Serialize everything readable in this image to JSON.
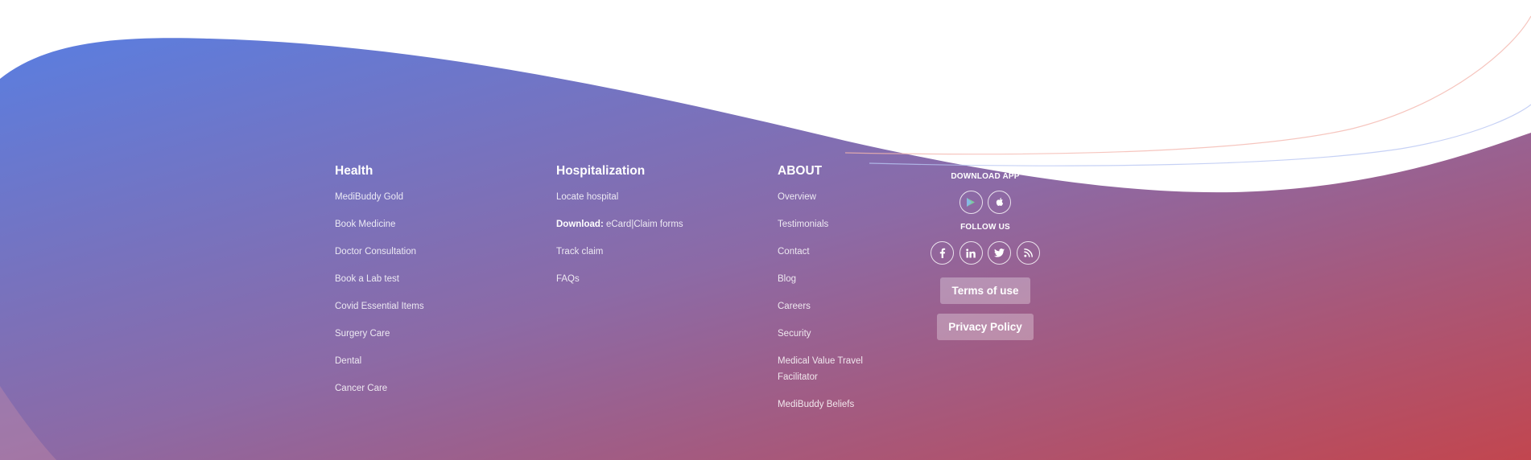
{
  "colors": {
    "gradient_start": "#5a7ee0",
    "gradient_mid": "#8c6aa6",
    "gradient_end": "#c2464f"
  },
  "health": {
    "heading": "Health",
    "links": [
      "MediBuddy Gold",
      "Book Medicine",
      "Doctor Consultation",
      "Book a Lab test",
      "Covid Essential Items",
      "Surgery Care",
      "Dental",
      "Cancer Care"
    ]
  },
  "hospitalization": {
    "heading": "Hospitalization",
    "links": [
      "Locate hospital"
    ],
    "download_prefix": "Download:",
    "download_ecard": "eCard",
    "download_separator": "|",
    "download_claim": "Claim forms",
    "links_after": [
      "Track claim",
      "FAQs"
    ]
  },
  "about": {
    "heading": "ABOUT",
    "links": [
      "Overview",
      "Testimonials",
      "Contact",
      "Blog",
      "Careers",
      "Security",
      "Medical Value Travel Facilitator",
      "MediBuddy Beliefs"
    ]
  },
  "download_app": {
    "heading": "DOWNLOAD APP",
    "icons": [
      "google-play-icon",
      "apple-icon"
    ]
  },
  "follow_us": {
    "heading": "FOLLOW US",
    "icons": [
      "facebook-icon",
      "linkedin-icon",
      "twitter-icon",
      "rss-icon"
    ]
  },
  "legal": {
    "terms": "Terms of use",
    "privacy": "Privacy Policy"
  }
}
